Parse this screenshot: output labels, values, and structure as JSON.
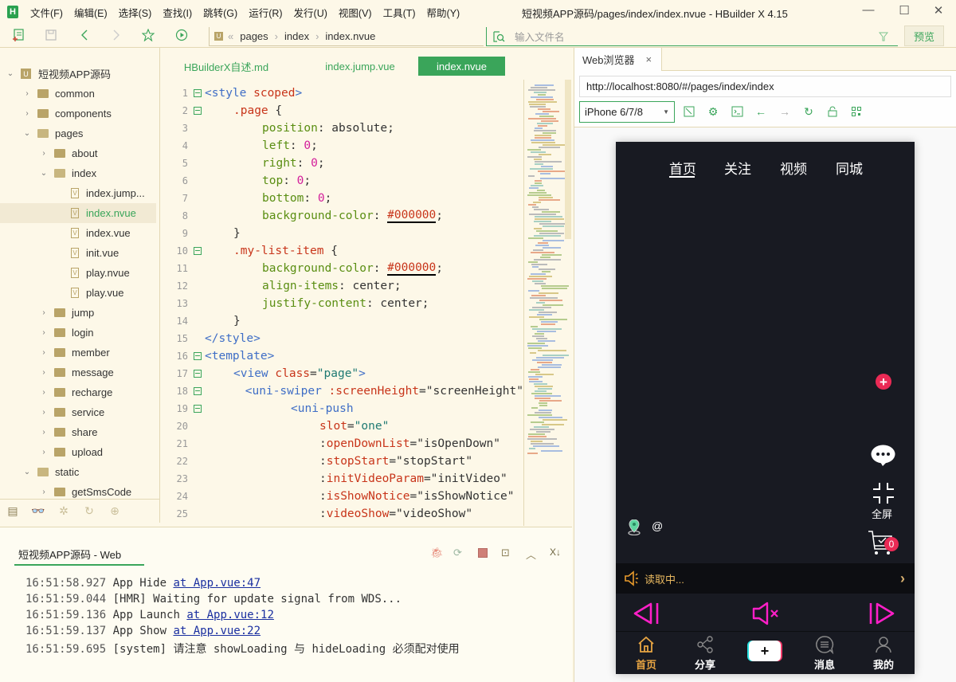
{
  "app": {
    "logo": "H",
    "title": "短视频APP源码/pages/index/index.nvue - HBuilder X 4.15",
    "menu": [
      "文件(F)",
      "编辑(E)",
      "选择(S)",
      "查找(I)",
      "跳转(G)",
      "运行(R)",
      "发行(U)",
      "视图(V)",
      "工具(T)",
      "帮助(Y)"
    ],
    "window_controls": {
      "minimize": "—",
      "maximize": "☐",
      "close": "✕"
    }
  },
  "toolbar": {
    "breadcrumb": [
      "pages",
      "index",
      "index.nvue"
    ],
    "breadcrumb_prefix": "«",
    "file_search_placeholder": "输入文件名",
    "preview_label": "预览",
    "icons": [
      "new-file-icon",
      "save-icon",
      "back-icon",
      "forward-icon",
      "favorite-icon",
      "run-icon"
    ]
  },
  "sidebar": {
    "project": "短视频APP源码",
    "items": [
      {
        "label": "common",
        "type": "folder",
        "depth": 1,
        "expanded": false
      },
      {
        "label": "components",
        "type": "folder",
        "depth": 1,
        "expanded": false
      },
      {
        "label": "pages",
        "type": "folder",
        "depth": 1,
        "expanded": true
      },
      {
        "label": "about",
        "type": "folder",
        "depth": 2,
        "expanded": false
      },
      {
        "label": "index",
        "type": "folder",
        "depth": 2,
        "expanded": true
      },
      {
        "label": "index.jump...",
        "type": "file",
        "depth": 3
      },
      {
        "label": "index.nvue",
        "type": "file",
        "depth": 3,
        "selected": true
      },
      {
        "label": "index.vue",
        "type": "file",
        "depth": 3
      },
      {
        "label": "init.vue",
        "type": "file",
        "depth": 3
      },
      {
        "label": "play.nvue",
        "type": "file",
        "depth": 3
      },
      {
        "label": "play.vue",
        "type": "file",
        "depth": 3
      },
      {
        "label": "jump",
        "type": "folder",
        "depth": 2,
        "expanded": false
      },
      {
        "label": "login",
        "type": "folder",
        "depth": 2,
        "expanded": false
      },
      {
        "label": "member",
        "type": "folder",
        "depth": 2,
        "expanded": false
      },
      {
        "label": "message",
        "type": "folder",
        "depth": 2,
        "expanded": false
      },
      {
        "label": "recharge",
        "type": "folder",
        "depth": 2,
        "expanded": false
      },
      {
        "label": "service",
        "type": "folder",
        "depth": 2,
        "expanded": false
      },
      {
        "label": "share",
        "type": "folder",
        "depth": 2,
        "expanded": false
      },
      {
        "label": "upload",
        "type": "folder",
        "depth": 2,
        "expanded": false
      },
      {
        "label": "static",
        "type": "folder",
        "depth": 1,
        "expanded": true
      },
      {
        "label": "getSmsCode",
        "type": "folder",
        "depth": 2,
        "expanded": false
      }
    ],
    "bottom_icons": [
      "project-icon",
      "binoculars-icon",
      "bug-icon",
      "plugin-icon",
      "cloud-icon"
    ]
  },
  "editor": {
    "tabs": [
      {
        "label": "HBuilderX自述.md",
        "active": false
      },
      {
        "label": "index.jump.vue",
        "active": false
      },
      {
        "label": "index.nvue",
        "active": true
      }
    ],
    "lines": [
      {
        "n": "1",
        "fold": true,
        "ind": 0,
        "tokens": [
          [
            "tag",
            "<style "
          ],
          [
            "attr",
            "scoped"
          ],
          [
            "tag",
            ">"
          ]
        ]
      },
      {
        "n": "2",
        "fold": true,
        "ind": 1,
        "tokens": [
          [
            "sel",
            ".page "
          ],
          [
            "pl",
            "{"
          ]
        ]
      },
      {
        "n": "3",
        "fold": false,
        "ind": 2,
        "tokens": [
          [
            "prop",
            "position"
          ],
          [
            "pl",
            ": absolute;"
          ]
        ]
      },
      {
        "n": "4",
        "fold": false,
        "ind": 2,
        "tokens": [
          [
            "prop",
            "left"
          ],
          [
            "pl",
            ": "
          ],
          [
            "num",
            "0"
          ],
          [
            "pl",
            ";"
          ]
        ]
      },
      {
        "n": "5",
        "fold": false,
        "ind": 2,
        "tokens": [
          [
            "prop",
            "right"
          ],
          [
            "pl",
            ": "
          ],
          [
            "num",
            "0"
          ],
          [
            "pl",
            ";"
          ]
        ]
      },
      {
        "n": "6",
        "fold": false,
        "ind": 2,
        "tokens": [
          [
            "prop",
            "top"
          ],
          [
            "pl",
            ": "
          ],
          [
            "num",
            "0"
          ],
          [
            "pl",
            ";"
          ]
        ]
      },
      {
        "n": "7",
        "fold": false,
        "ind": 2,
        "tokens": [
          [
            "prop",
            "bottom"
          ],
          [
            "pl",
            ": "
          ],
          [
            "num",
            "0"
          ],
          [
            "pl",
            ";"
          ]
        ]
      },
      {
        "n": "8",
        "fold": false,
        "ind": 2,
        "tokens": [
          [
            "prop",
            "background-color"
          ],
          [
            "pl",
            ": "
          ],
          [
            "hex",
            "#000000"
          ],
          [
            "pl",
            ";"
          ]
        ]
      },
      {
        "n": "9",
        "fold": false,
        "ind": 1,
        "tokens": [
          [
            "pl",
            "}"
          ]
        ]
      },
      {
        "n": "10",
        "fold": true,
        "ind": 1,
        "tokens": [
          [
            "sel",
            ".my-list-item "
          ],
          [
            "pl",
            "{"
          ]
        ]
      },
      {
        "n": "11",
        "fold": false,
        "ind": 2,
        "tokens": [
          [
            "prop",
            "background-color"
          ],
          [
            "pl",
            ": "
          ],
          [
            "hex",
            "#000000"
          ],
          [
            "pl",
            ";"
          ]
        ]
      },
      {
        "n": "12",
        "fold": false,
        "ind": 2,
        "tokens": [
          [
            "prop",
            "align-items"
          ],
          [
            "pl",
            ": center;"
          ]
        ]
      },
      {
        "n": "13",
        "fold": false,
        "ind": 2,
        "tokens": [
          [
            "prop",
            "justify-content"
          ],
          [
            "pl",
            ": center;"
          ]
        ]
      },
      {
        "n": "14",
        "fold": false,
        "ind": 1,
        "tokens": [
          [
            "pl",
            "}"
          ]
        ]
      },
      {
        "n": "15",
        "fold": false,
        "ind": 0,
        "tokens": [
          [
            "tag",
            "</style>"
          ]
        ]
      },
      {
        "n": "16",
        "fold": true,
        "ind": 0,
        "tokens": [
          [
            "tag",
            "<template>"
          ]
        ]
      },
      {
        "n": "17",
        "fold": true,
        "ind": 1,
        "tokens": [
          [
            "tag",
            "<view "
          ],
          [
            "attr",
            "class"
          ],
          [
            "pl",
            "="
          ],
          [
            "str",
            "\"page\""
          ],
          [
            "tag",
            ">"
          ]
        ]
      },
      {
        "n": "18",
        "fold": true,
        "ind": 2,
        "tokens": [
          [
            "tag",
            "<uni-swiper "
          ],
          [
            "attr",
            ":screenHeight"
          ],
          [
            "pl",
            "=\"screenHeight\""
          ]
        ]
      },
      {
        "n": "19",
        "fold": true,
        "ind": 3,
        "tokens": [
          [
            "tag",
            "<uni-push"
          ]
        ]
      },
      {
        "n": "20",
        "fold": false,
        "ind": 4,
        "tokens": [
          [
            "attr",
            "slot"
          ],
          [
            "pl",
            "="
          ],
          [
            "str",
            "\"one\""
          ]
        ]
      },
      {
        "n": "21",
        "fold": false,
        "ind": 4,
        "tokens": [
          [
            "pl",
            ":"
          ],
          [
            "attr",
            "openDownList"
          ],
          [
            "pl",
            "=\"isOpenDown\""
          ]
        ]
      },
      {
        "n": "22",
        "fold": false,
        "ind": 4,
        "tokens": [
          [
            "pl",
            ":"
          ],
          [
            "attr",
            "stopStart"
          ],
          [
            "pl",
            "=\"stopStart\""
          ]
        ]
      },
      {
        "n": "23",
        "fold": false,
        "ind": 4,
        "tokens": [
          [
            "pl",
            ":"
          ],
          [
            "attr",
            "initVideoParam"
          ],
          [
            "pl",
            "=\"initVideo\""
          ]
        ]
      },
      {
        "n": "24",
        "fold": false,
        "ind": 4,
        "tokens": [
          [
            "pl",
            ":"
          ],
          [
            "attr",
            "isShowNotice"
          ],
          [
            "pl",
            "=\"isShowNotice\""
          ]
        ]
      },
      {
        "n": "25",
        "fold": false,
        "ind": 4,
        "tokens": [
          [
            "pl",
            ":"
          ],
          [
            "attr",
            "videoShow"
          ],
          [
            "pl",
            "=\"videoShow\""
          ]
        ]
      }
    ]
  },
  "console": {
    "tab_label": "短视频APP源码 - Web",
    "icons": [
      "debug-icon",
      "restart-icon",
      "stop-icon",
      "terminal-icon",
      "collapse-icon",
      "clear-icon"
    ],
    "logs": [
      {
        "time": "16:51:58.927",
        "msg": "App Hide ",
        "link": "at App.vue:47"
      },
      {
        "time": "16:51:59.044",
        "msg": "[HMR] Waiting for update signal from WDS...",
        "link": ""
      },
      {
        "time": "16:51:59.136",
        "msg": "App Launch ",
        "link": "at App.vue:12"
      },
      {
        "time": "16:51:59.137",
        "msg": "App Show ",
        "link": "at App.vue:22"
      },
      {
        "time": "16:51:59.695",
        "msg": "[system] 请注意 showLoading 与 hideLoading 必须配对使用",
        "link": ""
      }
    ]
  },
  "browser": {
    "tab_label": "Web浏览器",
    "url": "http://localhost:8080/#/pages/index/index",
    "device": "iPhone 6/7/8",
    "phone": {
      "top_tabs": [
        "首页",
        "关注",
        "视频",
        "同城"
      ],
      "active_top_tab": 0,
      "fullscreen_label": "全屏",
      "cart_count": "0",
      "at_symbol": "@",
      "notice": "读取中...",
      "tabbar": [
        {
          "label": "首页",
          "active": true
        },
        {
          "label": "分享",
          "active": false
        },
        {
          "label": "",
          "active": false
        },
        {
          "label": "消息",
          "active": false
        },
        {
          "label": "我的",
          "active": false
        }
      ],
      "colors": {
        "accent": "#ea2a55",
        "control": "#ff1fc8",
        "notice_text": "#e8b860",
        "tab_active": "#e8a543",
        "bg": "#181a22"
      }
    }
  }
}
